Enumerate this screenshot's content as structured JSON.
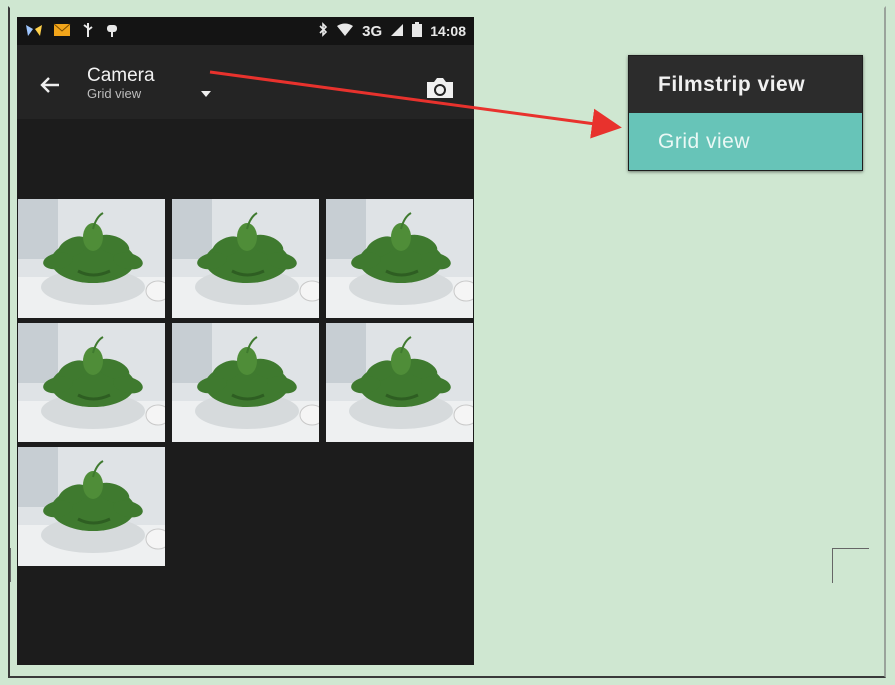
{
  "statusbar": {
    "network": "3G",
    "time": "14:08",
    "icons": [
      "notification-app-icon",
      "notification-mail-icon",
      "usb-icon",
      "android-debug-icon",
      "bluetooth-icon",
      "wifi-icon",
      "signal-icon",
      "battery-icon"
    ]
  },
  "appbar": {
    "title": "Camera",
    "subtitle": "Grid view",
    "back_icon": "arrow-left-icon",
    "dropdown_icon": "caret-down-icon",
    "camera_icon": "camera-icon"
  },
  "photos": [
    {
      "name": "photo-1"
    },
    {
      "name": "photo-2"
    },
    {
      "name": "photo-3"
    },
    {
      "name": "photo-4"
    },
    {
      "name": "photo-5"
    },
    {
      "name": "photo-6"
    },
    {
      "name": "photo-7"
    }
  ],
  "menu": {
    "items": [
      {
        "label": "Filmstrip view",
        "selected": false
      },
      {
        "label": "Grid view",
        "selected": true
      }
    ],
    "selected_color": "#67c4b8"
  },
  "annotation": {
    "arrow_color": "#e8322d"
  },
  "colors": {
    "page_background": "#cfe7d1",
    "phone_background": "#1c1c1c",
    "appbar_background": "#242424"
  }
}
